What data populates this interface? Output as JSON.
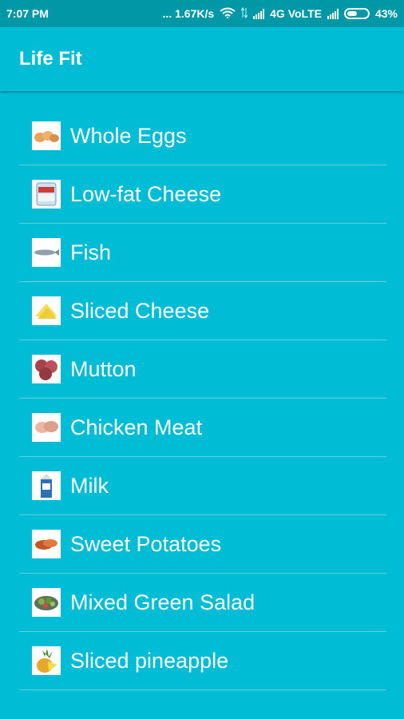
{
  "status_bar": {
    "time": "7:07 PM",
    "network_speed": "... 1.67K/s",
    "network_type": "4G VoLTE",
    "battery_percent": "43%",
    "icons": [
      "wifi-icon",
      "data-arrows-icon",
      "signal-icon",
      "signal-icon",
      "battery-icon"
    ]
  },
  "app_bar": {
    "title": "Life Fit"
  },
  "colors": {
    "primary": "#00bcd4",
    "primary_dark": "#0097a7",
    "text": "#ffffff"
  },
  "foods": [
    {
      "label": "Whole Eggs",
      "icon": "eggs-icon"
    },
    {
      "label": "Low-fat Cheese",
      "icon": "cheese-tub-icon"
    },
    {
      "label": "Fish",
      "icon": "fish-icon"
    },
    {
      "label": "Sliced Cheese",
      "icon": "cheese-slice-icon"
    },
    {
      "label": "Mutton",
      "icon": "mutton-icon"
    },
    {
      "label": "Chicken Meat",
      "icon": "chicken-meat-icon"
    },
    {
      "label": "Milk",
      "icon": "milk-carton-icon"
    },
    {
      "label": "Sweet Potatoes",
      "icon": "sweet-potato-icon"
    },
    {
      "label": "Mixed Green Salad",
      "icon": "salad-icon"
    },
    {
      "label": "Sliced pineapple",
      "icon": "pineapple-icon"
    }
  ]
}
